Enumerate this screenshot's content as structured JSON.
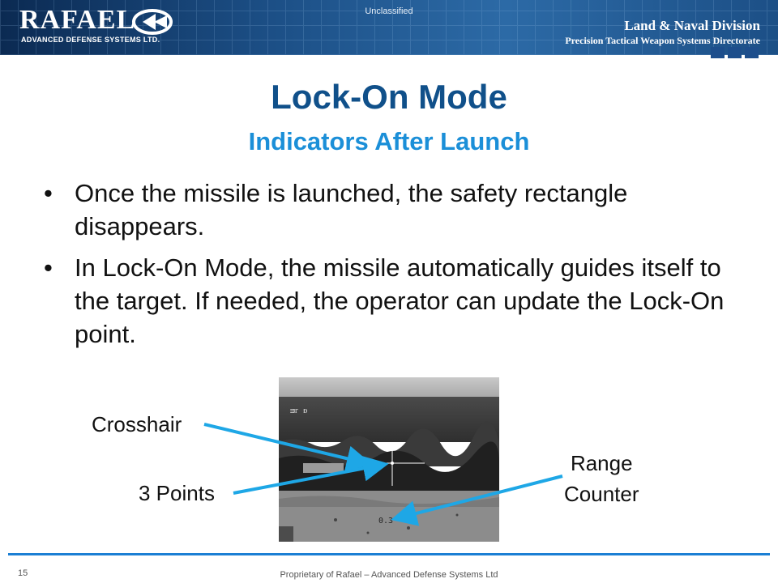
{
  "header": {
    "logo_text": "RAFAEL",
    "logo_subtext": "ADVANCED DEFENSE SYSTEMS LTD.",
    "classification": "Unclassified",
    "division_line1": "Land & Naval Division",
    "division_line2": "Precision Tactical Weapon Systems Directorate"
  },
  "slide": {
    "title": "Lock-On Mode",
    "subtitle": "Indicators After Launch",
    "bullets": [
      "Once the missile is launched, the safety rectangle disappears.",
      "In Lock-On Mode, the missile automatically guides itself to the target. If needed, the operator can update the Lock-On point."
    ],
    "bullet_glyph": "•"
  },
  "figure": {
    "labels": {
      "crosshair": "Crosshair",
      "three_points": "3 Points",
      "range_counter": "Range\nCounter"
    },
    "overlay_text_top": "ᴟᴦ ᴆ",
    "range_readout": "0.3",
    "arrow_color": "#1ea7e6"
  },
  "footer": {
    "page_number": "15",
    "text": "Proprietary of Rafael – Advanced Defense Systems Ltd"
  }
}
